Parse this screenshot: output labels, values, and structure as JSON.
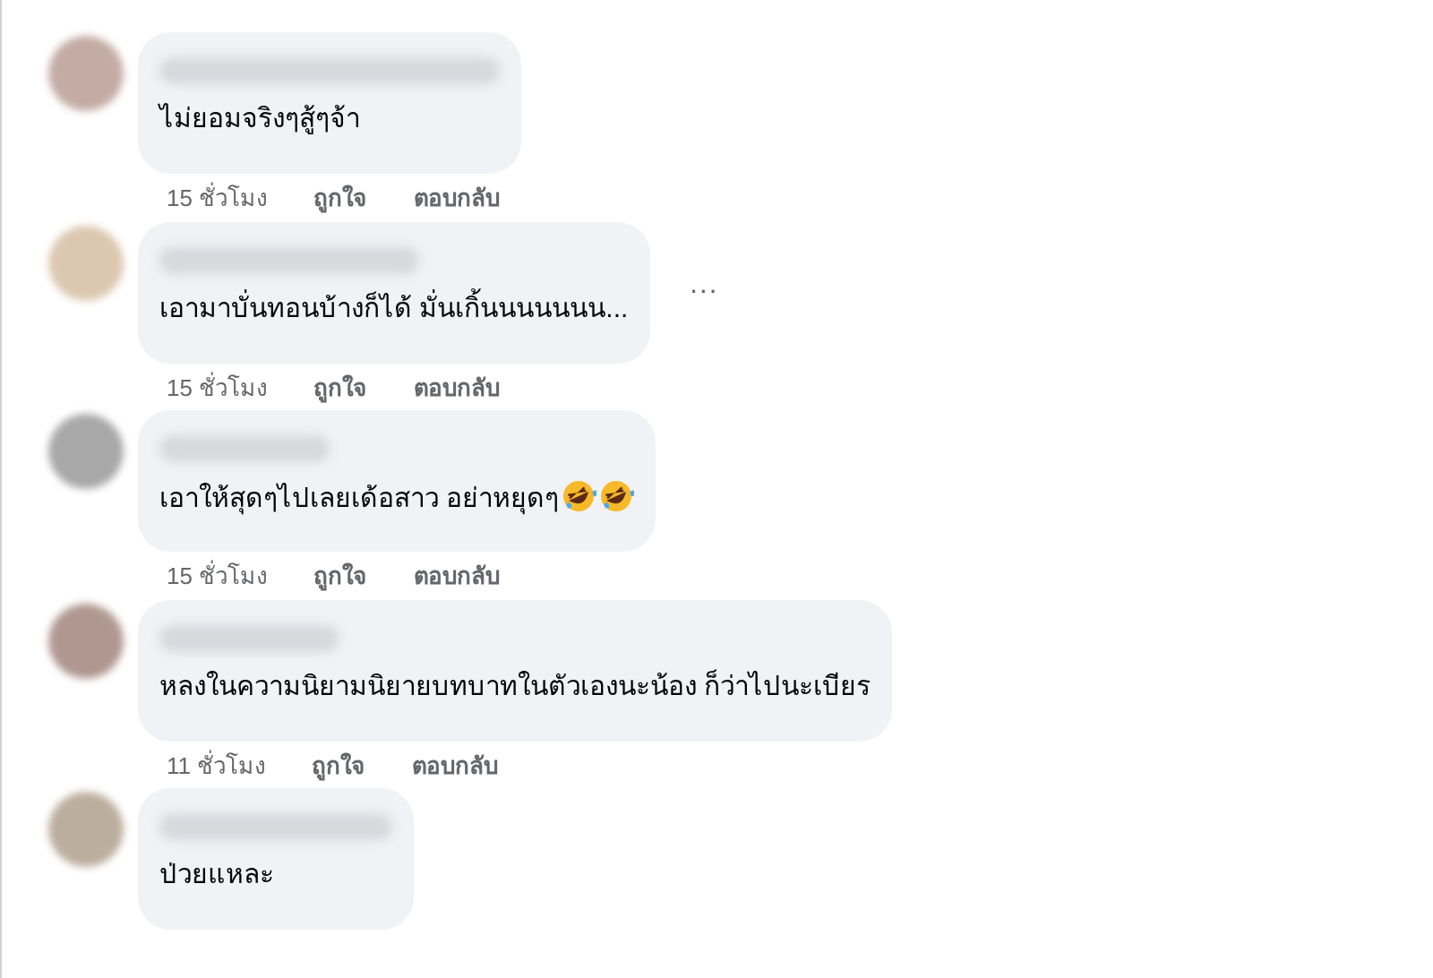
{
  "comments": [
    {
      "text": "ไม่ยอมจริงๆสู้ๆจ้า",
      "time": "15 ชั่วโมง",
      "like": "ถูกใจ",
      "reply": "ตอบกลับ"
    },
    {
      "text": "เอามาบั่นทอนบ้างก็ได้ มั่นเกิ้นนนนนนน...",
      "more_button": "···",
      "time": "15 ชั่วโมง",
      "like": "ถูกใจ",
      "reply": "ตอบกลับ"
    },
    {
      "text": "เอาให้สุดๆไปเลยเด้อสาว อย่าหยุดๆ",
      "reactions": [
        {
          "kind": "rofl"
        },
        {
          "kind": "rofl"
        }
      ],
      "time": "15 ชั่วโมง",
      "like": "ถูกใจ",
      "reply": "ตอบกลับ"
    },
    {
      "text": "หลงในความนิยามนิยายบทบาทในตัวเองนะน้อง ก็ว่าไปนะเบียร",
      "time": "11 ชั่วโมง",
      "like": "ถูกใจ",
      "reply": "ตอบกลับ"
    },
    {
      "text": "ป่วยแหละ"
    }
  ]
}
